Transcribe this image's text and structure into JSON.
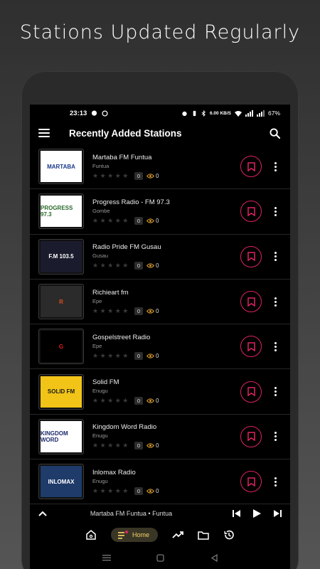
{
  "promo": {
    "title": "Stations Updated Regularly"
  },
  "status": {
    "time": "23:13",
    "data_rate": "6.00 KB/S",
    "battery": "67%"
  },
  "appbar": {
    "title": "Recently Added Stations"
  },
  "stations": [
    {
      "name": "Martaba FM Funtua",
      "city": "Funtua",
      "rating_count": "0",
      "views": "0",
      "logo_text": "MARTABA",
      "logo_bg": "#ffffff",
      "logo_fg": "#1a3a8a"
    },
    {
      "name": "Progress Radio - FM 97.3",
      "city": "Gombe",
      "rating_count": "0",
      "views": "0",
      "logo_text": "PROGRESS 97.3",
      "logo_bg": "#ffffff",
      "logo_fg": "#2a6a2a"
    },
    {
      "name": "Radio Pride FM Gusau",
      "city": "Gusau",
      "rating_count": "0",
      "views": "0",
      "logo_text": "F.M 103.5",
      "logo_bg": "#1b1b2e",
      "logo_fg": "#ffffff"
    },
    {
      "name": "Richieart fm",
      "city": "Epe",
      "rating_count": "0",
      "views": "0",
      "logo_text": "R",
      "logo_bg": "#2b2b2b",
      "logo_fg": "#e0501a"
    },
    {
      "name": "Gospelstreet Radio",
      "city": "Epe",
      "rating_count": "0",
      "views": "0",
      "logo_text": "G",
      "logo_bg": "#000000",
      "logo_fg": "#e0201a"
    },
    {
      "name": "Solid FM",
      "city": "Enugu",
      "rating_count": "0",
      "views": "0",
      "logo_text": "SOLID FM",
      "logo_bg": "#f2c418",
      "logo_fg": "#1a1a1a"
    },
    {
      "name": "Kingdom Word Radio",
      "city": "Enugu",
      "rating_count": "0",
      "views": "0",
      "logo_text": "KINGDOM WORD",
      "logo_bg": "#ffffff",
      "logo_fg": "#1a2a6a"
    },
    {
      "name": "Inlomax Radio",
      "city": "Enugu",
      "rating_count": "0",
      "views": "0",
      "logo_text": "INLOMAX",
      "logo_bg": "#1e3b6a",
      "logo_fg": "#ffffff"
    }
  ],
  "player": {
    "now_playing": "Martaba FM Funtua • Funtua"
  },
  "nav": {
    "home_label": "Home"
  },
  "colors": {
    "accent": "#e0245e",
    "views": "#e2a22a",
    "home_pill": "#f4d36a"
  }
}
